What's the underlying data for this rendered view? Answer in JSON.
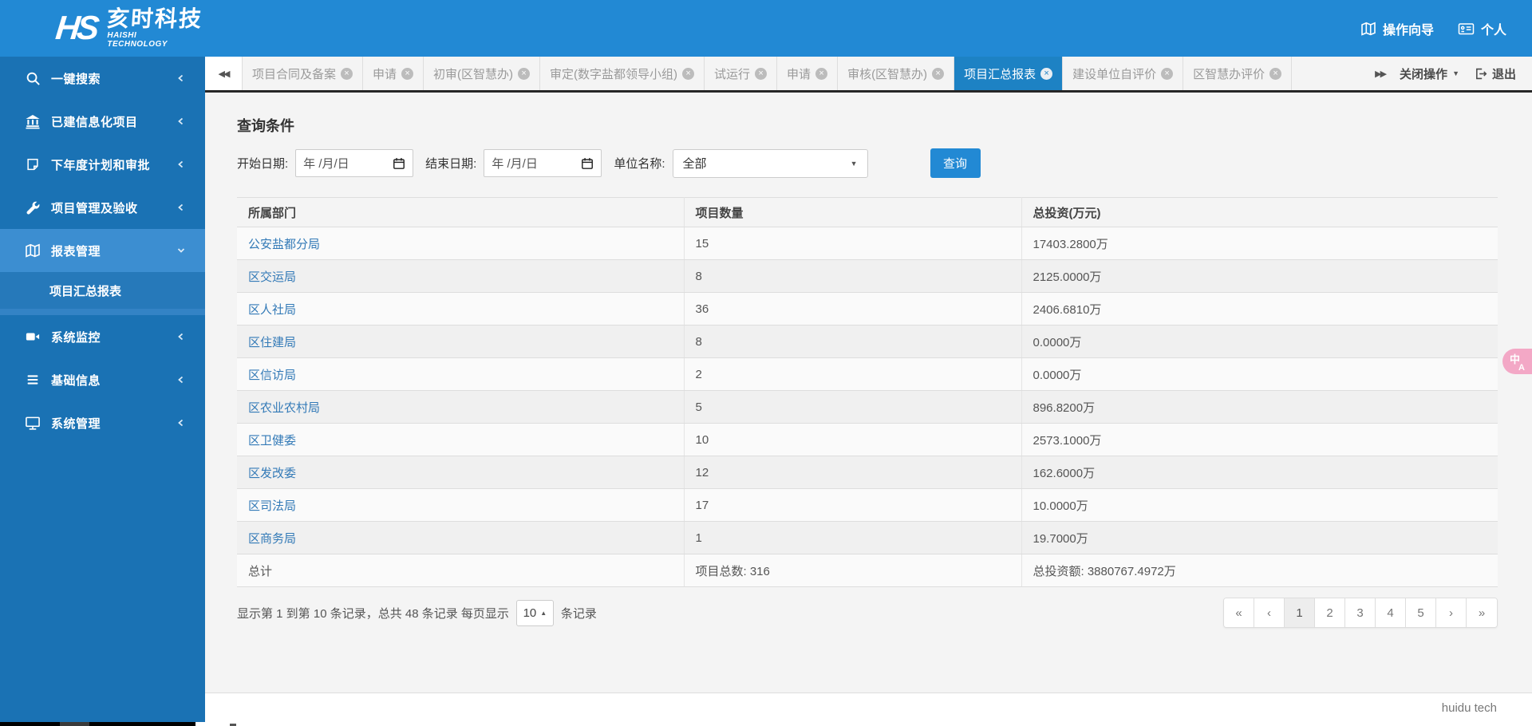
{
  "topbar": {
    "logo_mark": "HS",
    "logo_cn": "亥时科技",
    "logo_en_1": "HAISHI",
    "logo_en_2": "TECHNOLOGY",
    "guide": "操作向导",
    "profile": "个人"
  },
  "sidebar": {
    "items": [
      {
        "label": "一键搜索"
      },
      {
        "label": "已建信息化项目"
      },
      {
        "label": "下年度计划和审批"
      },
      {
        "label": "项目管理及验收"
      },
      {
        "label": "报表管理"
      },
      {
        "label": "系统监控"
      },
      {
        "label": "基础信息"
      },
      {
        "label": "系统管理"
      }
    ],
    "sub_item": {
      "label": "项目汇总报表"
    }
  },
  "tabs": {
    "list": [
      {
        "label": "项目合同及备案"
      },
      {
        "label": "申请"
      },
      {
        "label": "初审(区智慧办)"
      },
      {
        "label": "审定(数字盐都领导小组)"
      },
      {
        "label": "试运行"
      },
      {
        "label": "申请"
      },
      {
        "label": "审核(区智慧办)"
      },
      {
        "label": "项目汇总报表"
      },
      {
        "label": "建设单位自评价"
      },
      {
        "label": "区智慧办评价"
      }
    ],
    "close_ops": "关闭操作",
    "exit": "退出"
  },
  "query": {
    "title": "查询条件",
    "start_label": "开始日期:",
    "end_label": "结束日期:",
    "date_placeholder": "年 /月/日",
    "unit_label": "单位名称:",
    "unit_value": "全部",
    "search_button": "查询"
  },
  "table": {
    "headers": [
      "所属部门",
      "项目数量",
      "总投资(万元)"
    ],
    "rows": [
      [
        "公安盐都分局",
        "15",
        "17403.2800万"
      ],
      [
        "区交运局",
        "8",
        "2125.0000万"
      ],
      [
        "区人社局",
        "36",
        "2406.6810万"
      ],
      [
        "区住建局",
        "8",
        "0.0000万"
      ],
      [
        "区信访局",
        "2",
        "0.0000万"
      ],
      [
        "区农业农村局",
        "5",
        "896.8200万"
      ],
      [
        "区卫健委",
        "10",
        "2573.1000万"
      ],
      [
        "区发改委",
        "12",
        "162.6000万"
      ],
      [
        "区司法局",
        "17",
        "10.0000万"
      ],
      [
        "区商务局",
        "1",
        "19.7000万"
      ]
    ],
    "total_row": {
      "label": "总计",
      "projects": "项目总数: 316",
      "investment": "总投资额: 3880767.4972万"
    }
  },
  "pagination": {
    "summary_prefix": "显示第 1 到第 10 条记录，总共 48 条记录 每页显示",
    "page_size": "10",
    "summary_suffix": "条记录",
    "pages": [
      "«",
      "‹",
      "1",
      "2",
      "3",
      "4",
      "5",
      "›",
      "»"
    ]
  },
  "footer": {
    "credit": "huidu tech"
  },
  "fab": {
    "label_top": "中",
    "label_bottom": "A"
  },
  "icons": {
    "close": "×",
    "caret_down": "▼",
    "caret_up": "▲",
    "scroll_left": "◀◀",
    "scroll_right": "▶▶"
  }
}
